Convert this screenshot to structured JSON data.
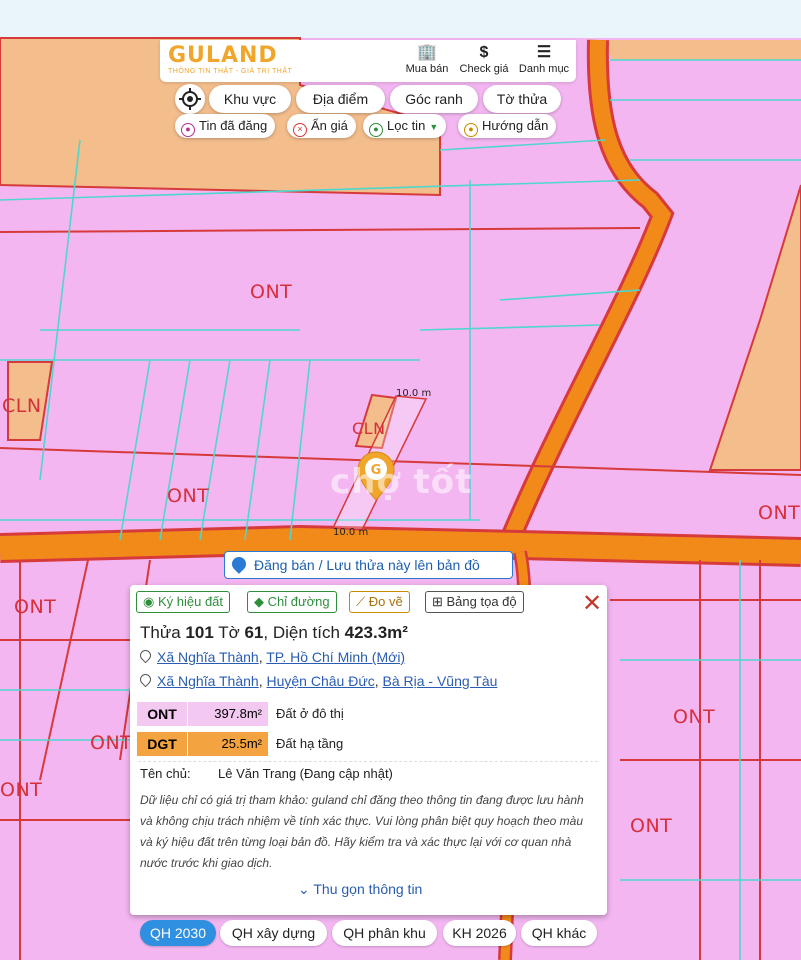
{
  "header": {
    "logo": "GULAND",
    "tagline": "THÔNG TIN THẬT - GIÁ TRỊ THẬT",
    "nav": [
      {
        "label": "Mua bán",
        "icon": "building-icon"
      },
      {
        "label": "Check giá",
        "icon": "dollar-icon"
      },
      {
        "label": "Danh mục",
        "icon": "menu-icon"
      }
    ]
  },
  "search_modes": [
    "Khu vực",
    "Địa điểm",
    "Góc ranh",
    "Tờ thửa"
  ],
  "filters": [
    {
      "label": "Tin đã đăng",
      "icon": "tag-icon",
      "color": "#b5318f"
    },
    {
      "label": "Ẩn giá",
      "icon": "hide-price-icon",
      "color": "#d33"
    },
    {
      "label": "Lọc tin",
      "icon": "filter-icon",
      "color": "#2d8f3c"
    },
    {
      "label": "Hướng dẫn",
      "icon": "guide-icon",
      "color": "#c58a00"
    }
  ],
  "map": {
    "labels": [
      "ONT",
      "CLN",
      "CLN",
      "ONT",
      "ONT",
      "ONT",
      "ONT",
      "ONT",
      "ONT",
      "ONT"
    ],
    "dimensions": [
      "10.0 m",
      "10.0 m"
    ],
    "watermark": "chợ tốt",
    "colors": {
      "residential": "#f3b6f1",
      "perennial": "#f3bd8c",
      "road": "#f28a1a"
    }
  },
  "save_bar": "Đăng bán / Lưu thửa này lên bản đồ",
  "popup": {
    "tools": [
      "Ký hiệu đất",
      "Chỉ đường",
      "Đo vẽ",
      "Bảng tọa độ"
    ],
    "title": {
      "t1": "Thửa ",
      "plot": "101",
      "t2": " Tờ ",
      "sheet": "61",
      "t3": ", Diện tích ",
      "area": "423.3m²"
    },
    "address_new": [
      "Xã Nghĩa Thành",
      "TP. Hồ Chí Minh (Mới)"
    ],
    "address_old": [
      "Xã Nghĩa Thành",
      "Huyện Châu Đức",
      "Bà Rịa - Vũng Tàu"
    ],
    "land_uses": [
      {
        "code": "ONT",
        "area": "397.8m²",
        "desc": "Đất ở đô thị",
        "color": "#f3c8f1"
      },
      {
        "code": "DGT",
        "area": "25.5m²",
        "desc": "Đất hạ tầng",
        "color": "#f3a440"
      }
    ],
    "owner_label": "Tên chủ:",
    "owner": "Lê Văn Trang (Đang cập nhật)",
    "disclaimer": "Dữ liệu chỉ có giá trị tham khảo: guland chỉ đăng theo thông tin đang được lưu hành và không chịu trách nhiệm về tính xác thực. Vui lòng phân biệt quy hoạch theo màu và ký hiệu đất trên từng loại bản đồ. Hãy kiểm tra và xác thực lại với cơ quan nhà nước trước khi giao dịch.",
    "collapse": "Thu gọn thông tin"
  },
  "tabs": [
    {
      "label": "QH 2030",
      "active": true
    },
    {
      "label": "QH xây dựng",
      "active": false
    },
    {
      "label": "QH phân khu",
      "active": false
    },
    {
      "label": "KH 2026",
      "active": false
    },
    {
      "label": "QH khác",
      "active": false
    }
  ]
}
